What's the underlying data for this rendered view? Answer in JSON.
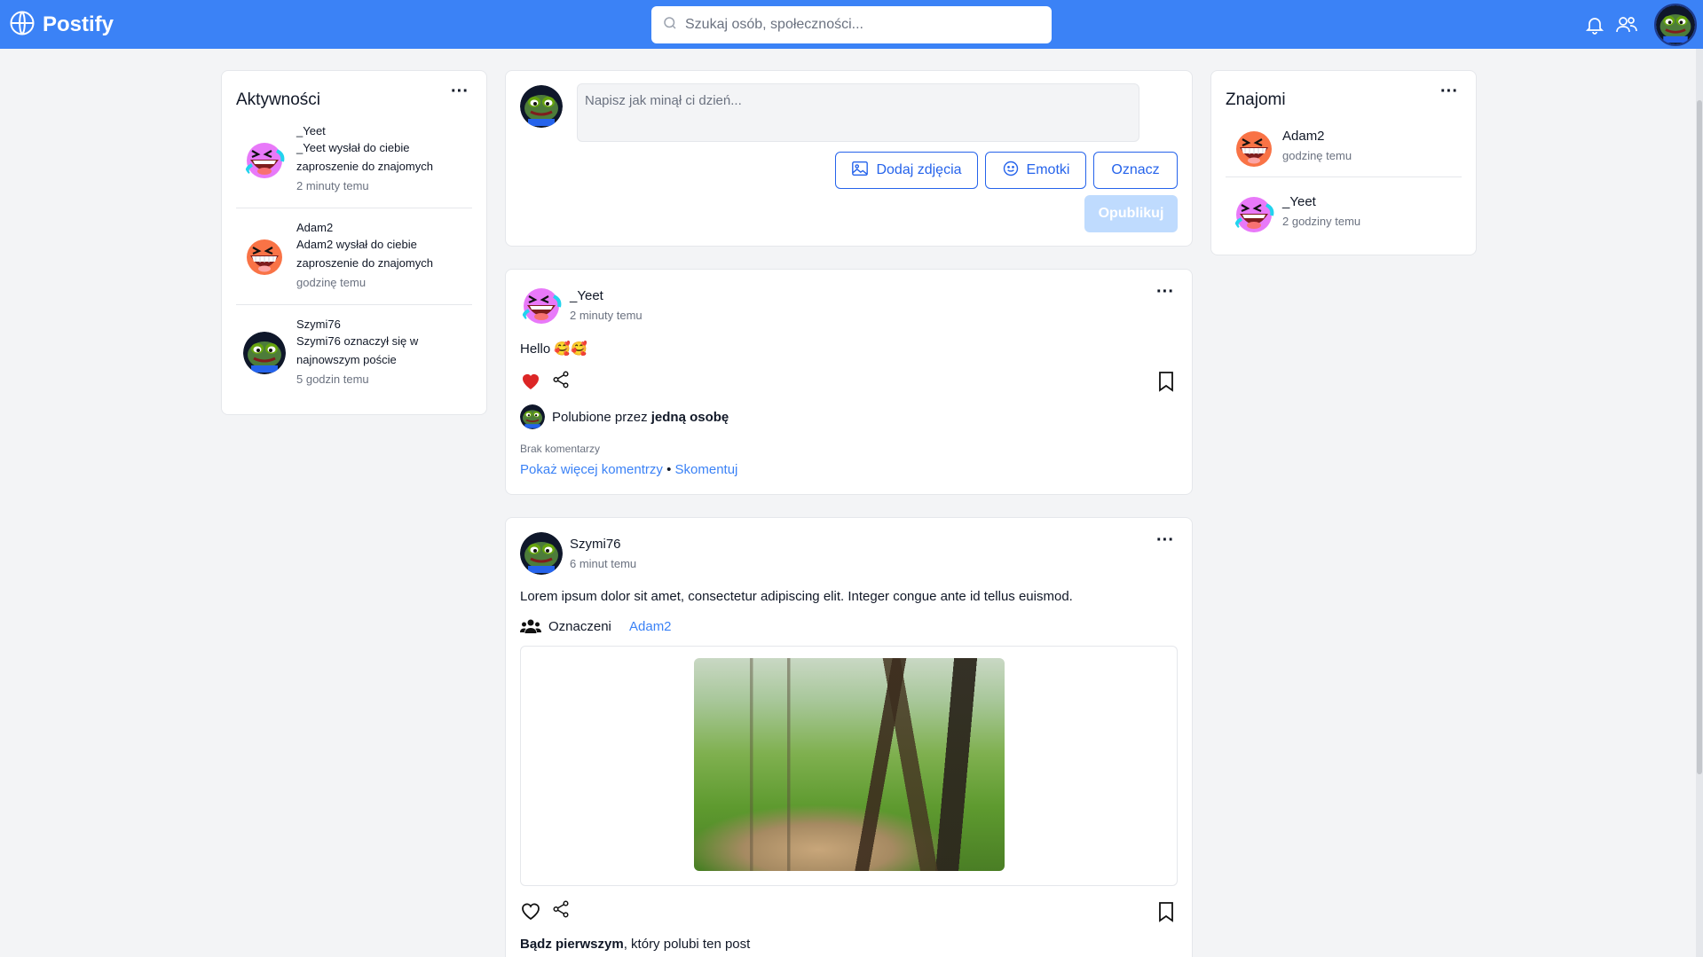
{
  "brand": {
    "name": "Postify"
  },
  "search": {
    "placeholder": "Szukaj osób, społeczności..."
  },
  "colors": {
    "primary": "#3b82f6",
    "heart": "#dc2626",
    "link": "#3b82f6"
  },
  "activities": {
    "title": "Aktywności",
    "items": [
      {
        "name": "_Yeet",
        "text": "_Yeet wysłał do ciebie zaproszenie do znajomych",
        "time": "2 minuty temu",
        "avatar": "laughing-avatar"
      },
      {
        "name": "Adam2",
        "text": "Adam2 wysłał do ciebie zaproszenie do znajomych",
        "time": "godzinę temu",
        "avatar": "orange-laughing-avatar"
      },
      {
        "name": "Szymi76",
        "text": "Szymi76 oznaczył się w najnowszym poście",
        "time": "5 godzin temu",
        "avatar": "frog-avatar"
      }
    ]
  },
  "composer": {
    "placeholder": "Napisz jak minął ci dzień...",
    "photos_label": "Dodaj zdjęcia",
    "emotes_label": "Emotki",
    "tag_label": "Oznacz",
    "publish_label": "Opublikuj"
  },
  "posts": [
    {
      "author": "_Yeet",
      "time": "2 minuty temu",
      "text": "Hello 🥰🥰",
      "liked": true,
      "liked_by_prefix": "Polubione przez",
      "liked_by_bold": "jedną osobę",
      "no_comments": "Brak komentarzy",
      "show_more": "Pokaż więcej komentrzy",
      "separator": "•",
      "comment": "Skomentuj"
    },
    {
      "author": "Szymi76",
      "time": "6 minut temu",
      "text": "Lorem ipsum dolor sit amet, consectetur adipiscing elit. Integer congue ante id tellus euismod.",
      "tagged_label": "Oznaczeni",
      "tagged_user": "Adam2",
      "liked": false,
      "be_first_bold": "Bądz pierwszym",
      "be_first_rest": ", który polubi ten post"
    }
  ],
  "friends": {
    "title": "Znajomi",
    "items": [
      {
        "name": "Adam2",
        "time": "godzinę temu",
        "avatar": "orange-laughing-avatar"
      },
      {
        "name": "_Yeet",
        "time": "2 godziny temu",
        "avatar": "laughing-avatar"
      }
    ]
  }
}
